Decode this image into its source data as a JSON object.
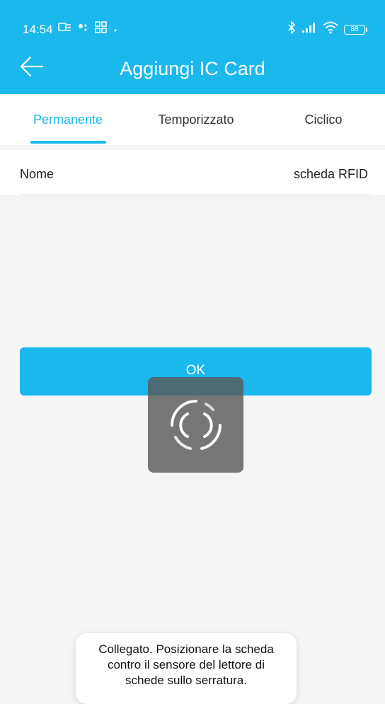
{
  "status_bar": {
    "time": "14:54",
    "battery": "88"
  },
  "header": {
    "title": "Aggiungi IC Card"
  },
  "tabs": [
    {
      "label": "Permanente",
      "active": true
    },
    {
      "label": "Temporizzato",
      "active": false
    },
    {
      "label": "Ciclico",
      "active": false
    }
  ],
  "form": {
    "name_label": "Nome",
    "name_value": "scheda RFID"
  },
  "ok_button": "OK",
  "toast": {
    "lines": [
      "Collegato. Posizionare la scheda",
      "contro il sensore del lettore di",
      "schede sullo serratura."
    ]
  },
  "colors": {
    "accent": "#1ab8ec",
    "background": "#f5f5f5",
    "overlay": "#5a5a5a"
  }
}
